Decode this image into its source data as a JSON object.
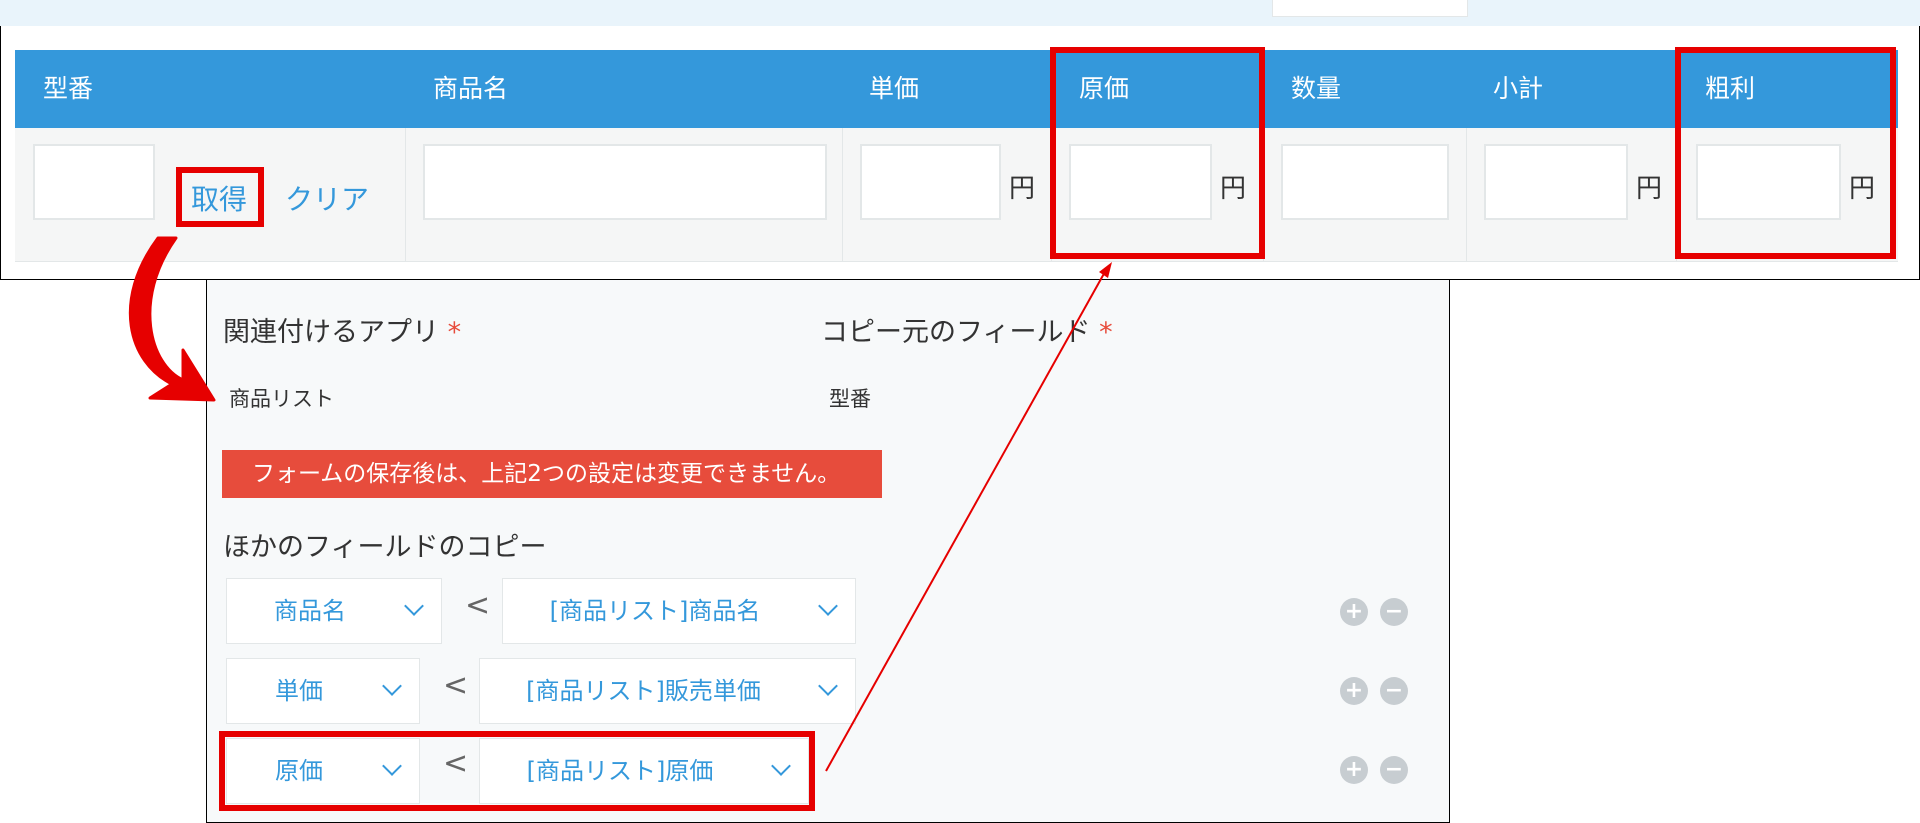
{
  "table": {
    "headers": [
      "型番",
      "商品名",
      "単価",
      "原価",
      "数量",
      "小計",
      "粗利"
    ],
    "get_link": "取得",
    "clear_link": "クリア",
    "unit": "円"
  },
  "lookup": {
    "related_app_label": "関連付けるアプリ",
    "related_app_value": "商品リスト",
    "copy_source_label": "コピー元のフィールド",
    "copy_source_value": "型番",
    "required_mark": "*",
    "warning": "フォームの保存後は、上記2つの設定は変更できません。",
    "other_fields_label": "ほかのフィールドのコピー",
    "mappings": [
      {
        "target": "商品名",
        "source": "[商品リスト]商品名"
      },
      {
        "target": "単価",
        "source": "[商品リスト]販売単価"
      },
      {
        "target": "原価",
        "source": "[商品リスト]原価"
      }
    ],
    "arrow_symbol": "<",
    "add_symbol": "+",
    "remove_symbol": "−"
  },
  "colors": {
    "header_blue": "#3498db",
    "annotation_red": "#e60000",
    "warning_red": "#e74c3c"
  }
}
